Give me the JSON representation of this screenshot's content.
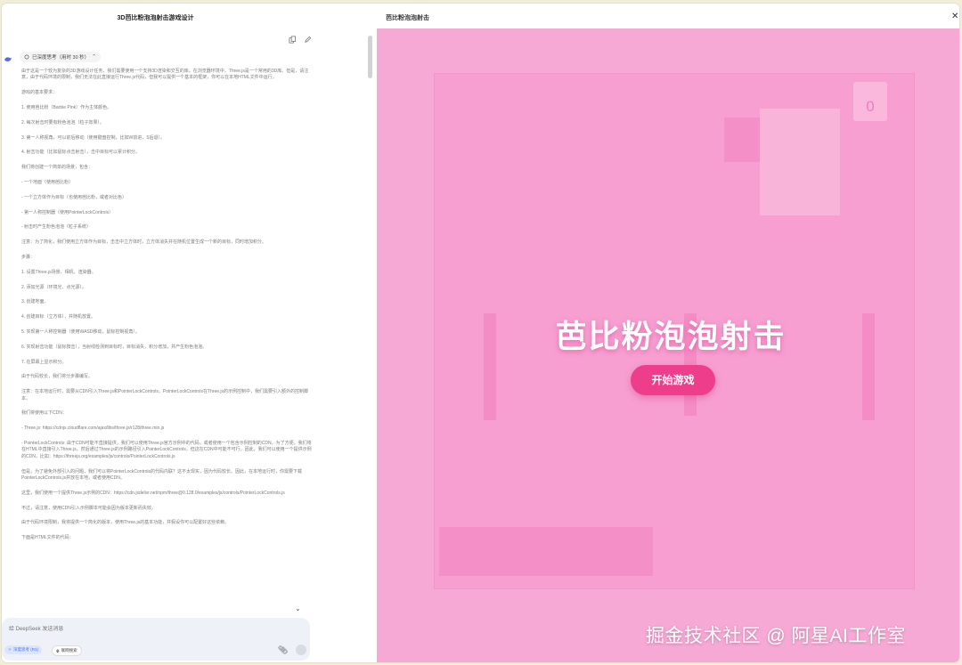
{
  "left": {
    "title": "3D芭比粉泡泡射击游戏设计",
    "think_label": "已深度思考（用时 30 秒）",
    "paragraphs": [
      "由于这是一个较为复杂的3D游戏设计任务，我们需要使用一个支持3D渲染和交互的库。在浏览器环境中，Three.js是一个常用的3D库。但是，请注意，由于代码环境的限制，我们无法在此直接运行Three.js代码，但我可以提供一个基本的框架，你可以在本地HTML文件中运行。",
      "游戏的基本要求：",
      "1. 使用芭比粉（Barbie Pink）作为主体颜色。",
      "2. 每次射击时要有粉色泡泡（粒子效果）。",
      "3. 第一人称视角，可以前后移动（使用键盘控制，比如W前进，S后退）。",
      "4. 射击功能（比如鼠标点击射击），击中目标可以累计积分。",
      "我们将创建一个简单的场景，包含：",
      "- 一个地面（使用芭比粉）",
      "- 一个立方体作为目标（也使用芭比粉，或者对比色）",
      "- 第一人称控制器（使用PointerLockControls）",
      "- 射击时产生粉色泡泡（粒子系统）",
      "注意：为了简化，我们使用立方体作为目标，击击中立方体时，立方体消失并在随机位置生成一个新的目标，同时增加积分。",
      "步骤：",
      "1. 设置Three.js场景、相机、渲染器。",
      "2. 添加光源（环境光、点光源）。",
      "3. 创建地面。",
      "4. 创建目标（立方体），并随机放置。",
      "5. 实现第一人称控制器（使用WASD移动，鼠标控制视角）。",
      "6. 实现射击功能（鼠标按击），当射线检测到目标时，目标消失，积分增加，并产生粉色泡泡。",
      "7. 在屏幕上显示积分。",
      "由于代码较长，我们将分步骤编写。",
      "注意：在本地运行时，需要从CDN引入Three.js和PointerLockControls。PointerLockControls在Three.js的示例控制中，我们需要引入额外的控制脚本。",
      "我们将使用以下CDN：",
      "- Three.js: https://cdnjs.cloudflare.com/ajax/libs/three.js/r128/three.min.js",
      "- PointerLockControls: 由于CDN可能不直接提供，我们可以使用Three.js官方示例中的代码，或者使用一个包含示例控制的CDN。为了方便，我们将在HTML中直接引入Three.js，然后通过Three.js的示例路径引入PointerLockControls，但这在CDN中可能不可行。因此，我们可以使用一个提供示例的CDN，比如：https://threejs.org/examples/js/controls/PointerLockControls.js",
      "但是，为了避免外部引入的问题，我们可以将PointerLockControls的代码内联？这不太现实，因为代码较长。因此，在本地运行时，你需要下载PointerLockControls.js并放在本地，或者使用CDN。",
      "这里，我们使用一个提供Three.js示例的CDN：https://cdn.jsdelivr.net/npm/three@0.128.0/examples/js/controls/PointerLockControls.js",
      "不过，请注意，使用CDN引入示例脚本可能会因为版本更新而失效。",
      "由于代码环境限制，我将提供一个简化的版本，使用Three.js的基本功能，并假设你可以配置好这些依赖。",
      "下面是HTML文件的代码："
    ],
    "input_placeholder": "给 DeepSeek 发送消息",
    "deep_think_label": "深度思考 (R1)",
    "web_search_label": "联网搜索"
  },
  "preview": {
    "title": "芭比粉泡泡射击",
    "score": "0",
    "game_title": "芭比粉泡泡射击",
    "start_button": "开始游戏",
    "watermark": "掘金技术社区 @ 阿星AI工作室"
  },
  "colors": {
    "barbie_pink": "#f7a9d6",
    "button_pink": "#ee3d8b",
    "deepseek_blue": "#4d6bfe"
  }
}
